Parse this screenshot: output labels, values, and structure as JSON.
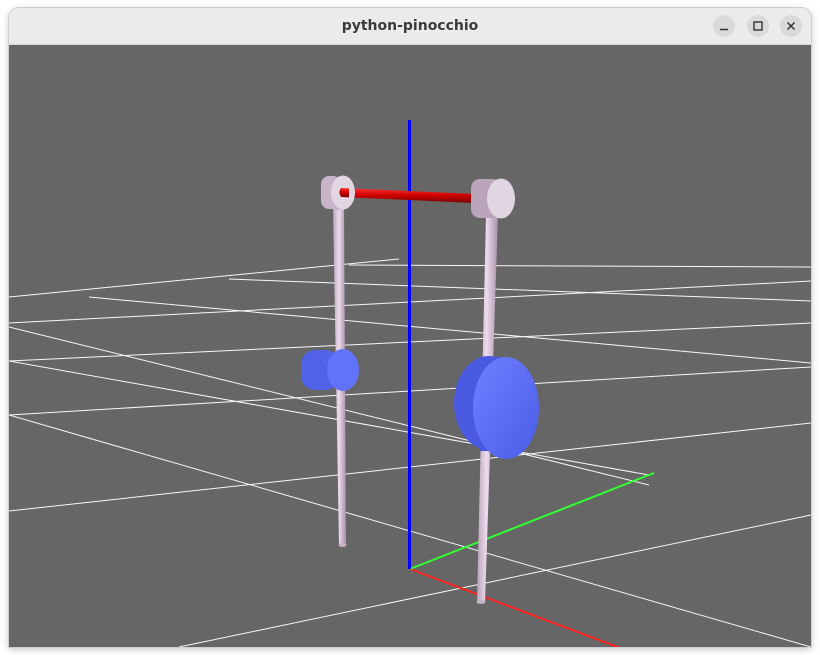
{
  "window": {
    "title": "python-pinocchio",
    "buttons": {
      "minimize_icon": "minimize-icon",
      "maximize_icon": "maximize-icon",
      "close_icon": "close-icon"
    }
  },
  "scene": {
    "background_color": "#666666",
    "grid_color": "#ffffff",
    "axis_colors": {
      "x": "#ff2020",
      "y": "#30ff30",
      "z": "#0000ff"
    },
    "link_color": "#d8c2d8",
    "joint_color": "#dcd0dc",
    "bar_color": "#cc0000",
    "disc_color": "#5a6cf5"
  }
}
